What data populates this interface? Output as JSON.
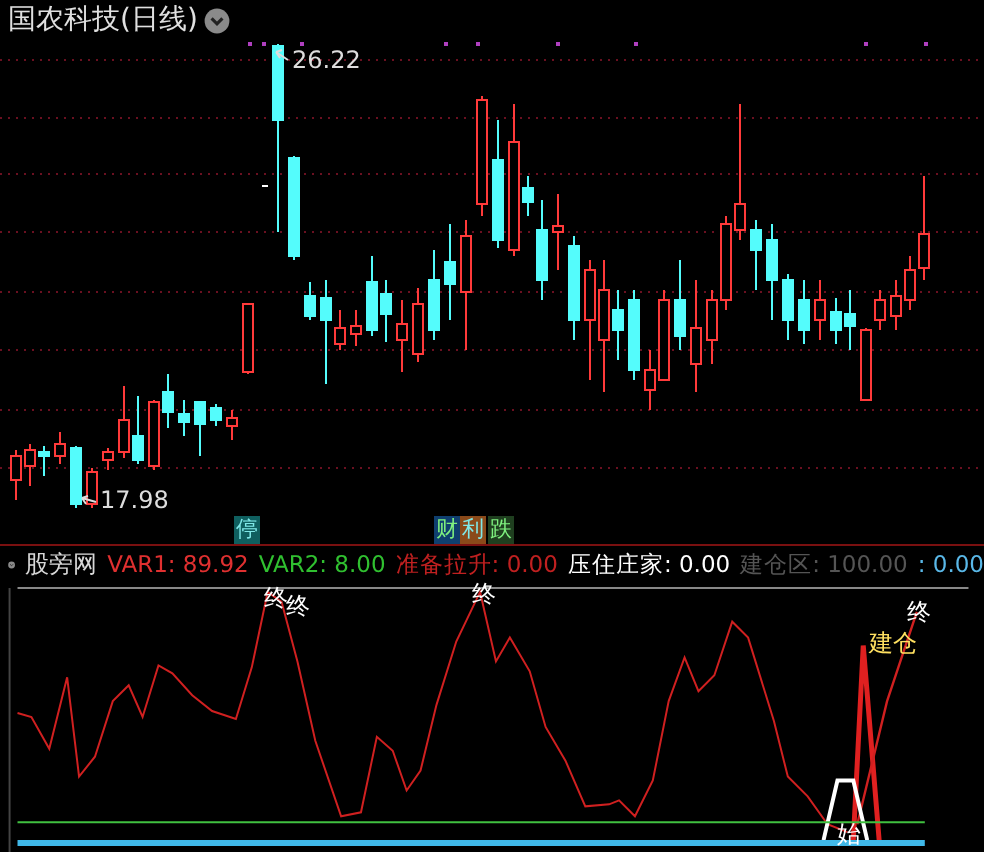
{
  "chart_title": "国农科技(日线)",
  "price_labels": [
    {
      "text": "26.22",
      "kind": "high"
    },
    {
      "text": "17.98",
      "kind": "low"
    }
  ],
  "event_badges": [
    {
      "text": "停",
      "color": "#0f5f5f"
    },
    {
      "text": "财",
      "color": "#0f3f6f"
    },
    {
      "text": "利",
      "color": "#8a4a1a"
    },
    {
      "text": "跌",
      "color": "#1f3f1f"
    }
  ],
  "indicator": {
    "name": "股旁网",
    "legend": [
      {
        "text": "VAR1: 89.92",
        "color": "#e03030"
      },
      {
        "text": "VAR2: 8.00",
        "color": "#30c030"
      },
      {
        "text": "准备拉升: 0.00",
        "color": "#c02020"
      },
      {
        "text": "压住庄家: 0.00",
        "color": "#ffffff"
      },
      {
        "text": "建仓区: 100.00",
        "color": "#555555"
      },
      {
        "text": ": 0.00",
        "color": "#5ab8e8"
      }
    ],
    "marks": [
      {
        "text": "终",
        "kind": "end"
      },
      {
        "text": "终",
        "kind": "end"
      },
      {
        "text": "终",
        "kind": "end"
      },
      {
        "text": "建仓",
        "kind": "build"
      },
      {
        "text": "终",
        "kind": "end"
      },
      {
        "text": "始",
        "kind": "start"
      }
    ]
  }
}
